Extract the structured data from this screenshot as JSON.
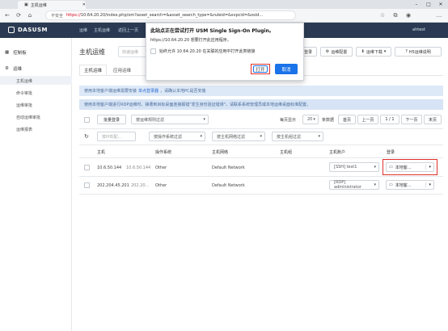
{
  "browser": {
    "tab_title": "主机运维",
    "url_warning": "不安全",
    "url_scheme": "https://",
    "url_rest": "10.64.20.20/index.php/om?asset_search=&asset_search_type=&ruleid=&svpcid=&osid..."
  },
  "app": {
    "brand": "DASUSM",
    "topnav": [
      "运维",
      "主机运维",
      "返回上一页"
    ],
    "user": "ahtest"
  },
  "sidebar": {
    "items": [
      {
        "label": "控制板"
      },
      {
        "label": "运维"
      }
    ],
    "subitems": [
      "主机运维",
      "命令审批",
      "运维审批",
      "自动运维审批",
      "运维报表"
    ]
  },
  "main": {
    "title": "主机运维",
    "search_placeholder": "快速运维",
    "toolbar": [
      "登录",
      "运维配置",
      "运维下载",
      "H5运维说明"
    ],
    "tabs": [
      "主机运维",
      "应用运维"
    ],
    "info1_pre": "使用本地客户端运维需要安装",
    "info1_link": "单点登录器",
    "info1_post": "，请确认本地PC是否安装",
    "info2": "使用本地客户端进行RDP运维时，弹遭到目标桌面连接报错\"发生身份验证错误\"，请联系系统管理员或本地运维桌面标准配置。",
    "batch_login": "批量登录",
    "rule_filter": "按运维规则过滤",
    "per_page_label": "每页显示",
    "per_page": "20",
    "total": "条数据",
    "pager": [
      "首页",
      "上一页",
      "1 / 1",
      "下一页",
      "末页"
    ],
    "filters": [
      "按操作系统过滤",
      "按主机网络过滤",
      "按主机组过滤"
    ],
    "ip_search_placeholder": "按IP匹配...",
    "headers": [
      "主机",
      "操作系统",
      "主机网络",
      "主机组",
      "主机账户",
      "登录"
    ],
    "rows": [
      {
        "host": "10.6.50.144",
        "host2": "10.6.50.144",
        "os": "Other",
        "network": "Default Network",
        "group": "",
        "account": "[SSH] test1",
        "login": "本地客..."
      },
      {
        "host": "202.204.45.201",
        "host2": "202.20...",
        "os": "Other",
        "network": "Default Network",
        "group": "",
        "account": "[RDP] administrator",
        "login": "本地客..."
      }
    ]
  },
  "dialog": {
    "title": "此站点正在尝试打开 USM Single Sign-On Plugin。",
    "subtitle": "https://10.64.20.20 想要打开此应用程序。",
    "checkbox": "始终允许 10.64.20.20 在关联的应用中打开此类链接",
    "open": "打开",
    "cancel": "取消"
  }
}
